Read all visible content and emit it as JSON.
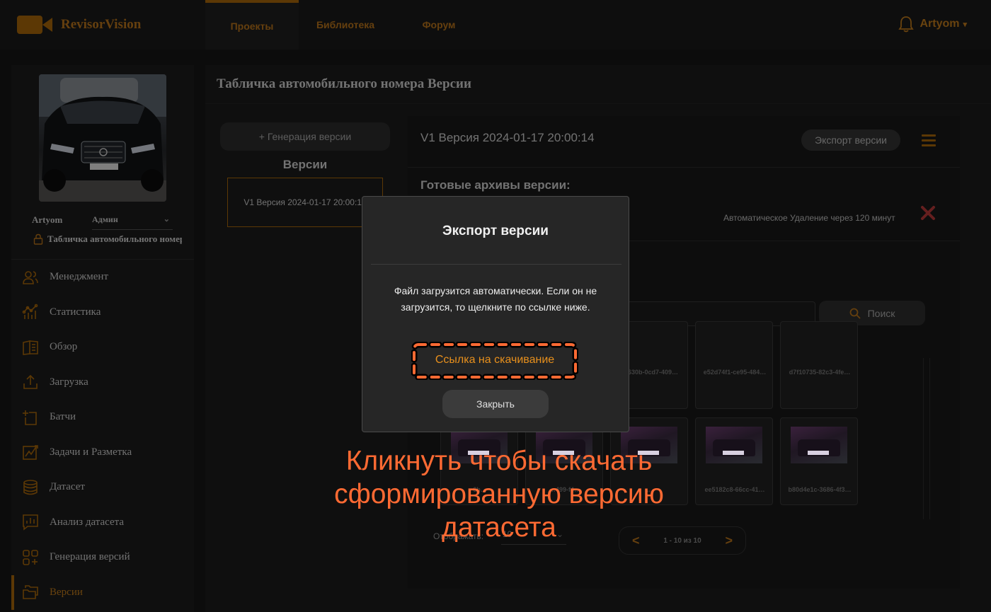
{
  "app": {
    "name": "RevisorVision"
  },
  "nav": {
    "tabs": [
      {
        "label": "Проекты"
      },
      {
        "label": "Библиотека"
      },
      {
        "label": "Форум"
      }
    ]
  },
  "user": {
    "name": "Artyom",
    "caret": "▾"
  },
  "sidebar": {
    "user_name": "Artyom",
    "role": "Админ",
    "project": "Табличка автомобильного номера",
    "items": [
      {
        "label": "Менеджмент",
        "icon": "users-icon"
      },
      {
        "label": "Статистика",
        "icon": "statistics-icon"
      },
      {
        "label": "Обзор",
        "icon": "book-icon"
      },
      {
        "label": "Загрузка",
        "icon": "upload-icon"
      },
      {
        "label": "Батчи",
        "icon": "batch-icon"
      },
      {
        "label": "Задачи и Разметка",
        "icon": "annotate-icon"
      },
      {
        "label": "Датасет",
        "icon": "database-icon"
      },
      {
        "label": "Анализ датасета",
        "icon": "analysis-icon"
      },
      {
        "label": "Генерация версий",
        "icon": "grid-plus-icon"
      },
      {
        "label": "Версии",
        "icon": "folders-icon"
      }
    ],
    "active_item": "Версии"
  },
  "page": {
    "title": "Табличка автомобильного номера Версии"
  },
  "versions": {
    "generate_label": "+ Генерация версии",
    "title": "Версии",
    "items": [
      "V1 Версия 2024-01-17 20:00:14"
    ]
  },
  "detail": {
    "title": "V1 Версия 2024-01-17 20:00:14",
    "export_label": "Экспорт версии",
    "archives_title": "Готовые архивы версии:",
    "auto_delete": "Автоматическое Удаление через 120 минут",
    "search_label": "Поиск",
    "images": [
      {
        "caption": "…630b-0cd7-409…"
      },
      {
        "caption": "e52d74f1-ce95-484…"
      },
      {
        "caption": "d7f10735-82c3-4fe…"
      },
      {
        "caption": "6b…"
      },
      {
        "caption": "…499-f4…"
      },
      {
        "caption": "…"
      },
      {
        "caption": "ee5182c8-66cc-41…"
      },
      {
        "caption": "b80d4e1c-3686-4f3…"
      }
    ],
    "per_page_label": "Отображать:",
    "per_page_value": "10",
    "pagination": {
      "prev": "<",
      "next": ">",
      "info": "1 - 10 из 10"
    }
  },
  "modal": {
    "title": "Экспорт версии",
    "message": "Файл загрузится автоматически. Если он не загрузится, то щелкните по ссылке ниже.",
    "link_label": "Ссылка на скачивание",
    "close_label": "Закрыть"
  },
  "annotation": "Кликнуть чтобы скачать сформированную версию датасета",
  "colors": {
    "accent": "#a8670a",
    "annotation": "#ff6a33",
    "delete": "#b83a3a"
  }
}
